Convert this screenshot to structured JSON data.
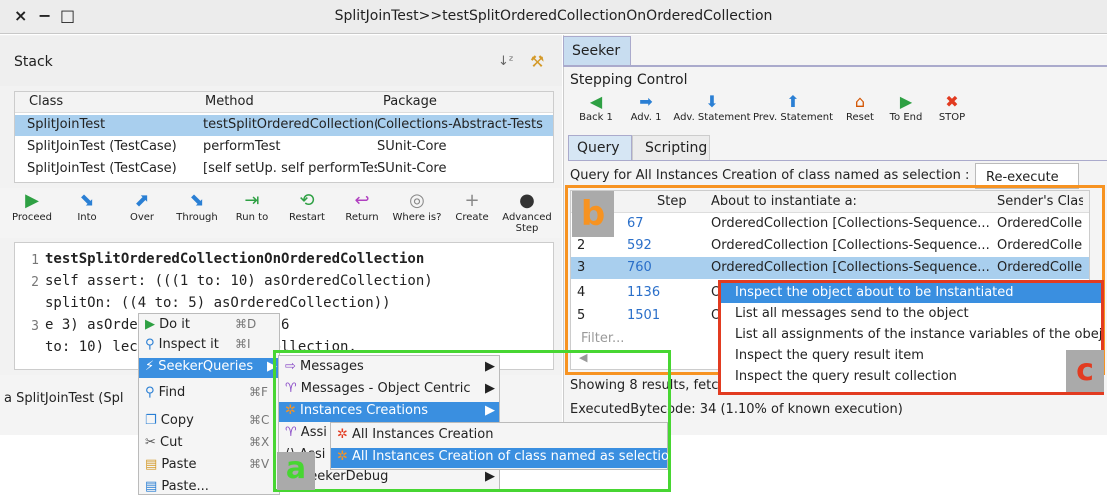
{
  "window": {
    "title": "SplitJoinTest>>testSplitOrderedCollectionOnOrderedCollection",
    "controls": [
      "×",
      "−",
      "□"
    ]
  },
  "stack": {
    "title": "Stack",
    "columns": [
      "Class",
      "Method",
      "Package"
    ],
    "rows": [
      [
        "SplitJoinTest",
        "testSplitOrderedCollection(",
        "Collections-Abstract-Tests"
      ],
      [
        "SplitJoinTest (TestCase)",
        "performTest",
        "SUnit-Core"
      ],
      [
        "SplitJoinTest (TestCase)",
        "[self setUp.  self performTes",
        "SUnit-Core"
      ]
    ]
  },
  "toolbar": {
    "items": [
      {
        "label": "Proceed",
        "glyph": "▶",
        "color": "#2ea043"
      },
      {
        "label": "Into",
        "glyph": "⬊",
        "color": "#2a7fd4"
      },
      {
        "label": "Over",
        "glyph": "⬈",
        "color": "#2a7fd4"
      },
      {
        "label": "Through",
        "glyph": "⬊",
        "color": "#2a7fd4"
      },
      {
        "label": "Run to",
        "glyph": "⇥",
        "color": "#2ea043"
      },
      {
        "label": "Restart",
        "glyph": "⟲",
        "color": "#2ea043"
      },
      {
        "label": "Return",
        "glyph": "↩",
        "color": "#b040c0"
      },
      {
        "label": "Where is?",
        "glyph": "◎",
        "color": "#888888"
      },
      {
        "label": "Create",
        "glyph": "+",
        "color": "#888888"
      },
      {
        "label": "Advanced Step",
        "glyph": "●",
        "color": "#333333"
      }
    ]
  },
  "code": {
    "lines": [
      {
        "num": "1",
        "text": "testSplitOrderedCollectionOnOrderedCollection"
      },
      {
        "num": "2",
        "text": "   self assert: (((1 to: 10) asOrderedCollection)"
      },
      {
        "num": "",
        "text": "splitOn: ((4 to: 5) asOrderedCollection))"
      },
      {
        "num": "3",
        "text": "     e                 3) asOrderedCollection . (6"
      },
      {
        "num": "",
        "text": "to: 10)                  lection] asOrderedCollection."
      }
    ]
  },
  "status": "a SplitJoinTest (Spl",
  "context_menu": {
    "items": [
      {
        "label": "Do it",
        "shortcut": "⌘D"
      },
      {
        "label": "Inspect it",
        "shortcut": "⌘I"
      },
      {
        "label": "SeekerQueries",
        "shortcut": ""
      },
      {
        "label": "Find",
        "shortcut": "⌘F"
      },
      {
        "label": "Copy",
        "shortcut": "⌘C"
      },
      {
        "label": "Cut",
        "shortcut": "⌘X"
      },
      {
        "label": "Paste",
        "shortcut": "⌘V"
      },
      {
        "label": "Paste...",
        "shortcut": ""
      }
    ]
  },
  "submenu": {
    "items": [
      "Messages",
      "Messages - Object Centric",
      "Instances Creations",
      "Assi",
      "Assi",
      "SeekerDebug"
    ]
  },
  "submenu2": {
    "items": [
      "All Instances Creation",
      "All Instances Creation of class named as selection"
    ]
  },
  "seeker": {
    "tab": "Seeker",
    "stepping_title": "Stepping Control",
    "steps": [
      {
        "label": "Back 1",
        "glyph": "◀"
      },
      {
        "label": "Adv. 1",
        "glyph": "➡"
      },
      {
        "label": "Adv. Statement",
        "glyph": "⬇"
      },
      {
        "label": "Prev. Statement",
        "glyph": "⬆"
      },
      {
        "label": "Reset",
        "glyph": "⌂"
      },
      {
        "label": "To End",
        "glyph": "▶"
      },
      {
        "label": "STOP",
        "glyph": "✖"
      }
    ],
    "tabs": [
      "Query",
      "Scripting"
    ],
    "query_label": "Query for All Instances Creation of class named as selection : (O",
    "reexecute": "Re-execute",
    "columns": [
      "Step",
      "About to instantiate a:",
      "Sender's Clas"
    ],
    "rows": [
      {
        "idx": "1",
        "step": "67",
        "about": "OrderedCollection [Collections-Sequence...",
        "sender": "OrderedColle"
      },
      {
        "idx": "2",
        "step": "592",
        "about": "OrderedCollection [Collections-Sequence...",
        "sender": "OrderedColle"
      },
      {
        "idx": "3",
        "step": "760",
        "about": "OrderedCollection [Collections-Sequence...",
        "sender": "OrderedColle"
      },
      {
        "idx": "4",
        "step": "1136",
        "about": "O",
        "sender": ""
      },
      {
        "idx": "5",
        "step": "1501",
        "about": "O",
        "sender": ""
      }
    ],
    "filter_placeholder": "Filter...",
    "showing": "Showing 8 results, fetc",
    "executed": "ExecutedBytecode: 34 (1.10% of known execution)"
  },
  "result_menu": {
    "items": [
      "Inspect the object about to be Instantiated",
      "List all messages send to the object",
      "List all assignments of the instance variables of the obeject",
      "Inspect the query result item",
      "Inspect the query result collection"
    ]
  },
  "badges": {
    "a": "a",
    "b": "b",
    "c": "c"
  },
  "colors": {
    "selection": "#a9cfee",
    "menu_highlight": "#3a8fe0",
    "orange": "#f79321",
    "red": "#e23b20",
    "green": "#47d632"
  }
}
